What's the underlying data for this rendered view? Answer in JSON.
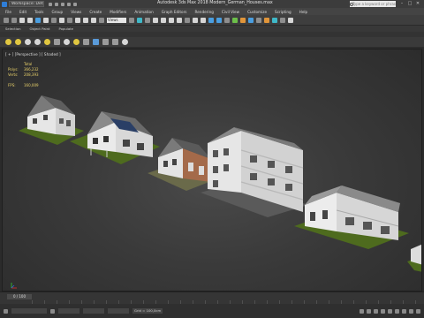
{
  "titlebar": {
    "workspace": "Workspace: Default",
    "window_title": "Autodesk 3ds Max 2018    Modern_German_Houses.max",
    "search_placeholder": "Type a keyword or phrase",
    "minimize": "–",
    "maximize": "□",
    "close": "✕"
  },
  "menubar": {
    "items": [
      "File",
      "Edit",
      "Tools",
      "Group",
      "Views",
      "Create",
      "Modifiers",
      "Animation",
      "Graph Editors",
      "Rendering",
      "Civil View",
      "Customize",
      "Scripting",
      "Help"
    ]
  },
  "toolbar": {
    "selection_filter": "Views"
  },
  "ribbon": {
    "tabs": [
      "Selection",
      "Object Paint",
      "Populate"
    ]
  },
  "viewport": {
    "label": "[ + ] [Perspective ] [ Shaded ]",
    "stats": {
      "header": "Total",
      "polys_label": "Polys:",
      "polys_value": "366,232",
      "verts_label": "Verts:",
      "verts_value": "208,393",
      "fps_label": "FPS:",
      "fps_value": "160,009"
    },
    "colors": {
      "grass": "#4e6b1e",
      "wall": "#e8e8e8",
      "roof": "#6e6e6e",
      "brick": "#a46a4a"
    }
  },
  "timeline": {
    "frame_counter": "0 / 100"
  },
  "statusbar": {
    "grid": "Grid = 100,0cm"
  }
}
